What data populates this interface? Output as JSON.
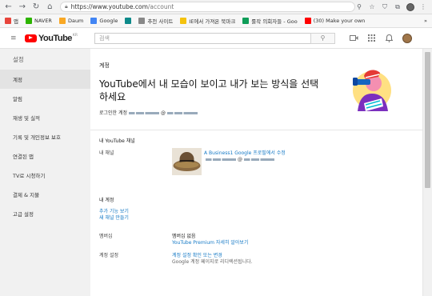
{
  "browser": {
    "url_host": "https://www.youtube.com",
    "url_path": "/account",
    "bookmarks": [
      {
        "label": "앱",
        "color": "#e8453c"
      },
      {
        "label": "NAVER",
        "color": "#2db400"
      },
      {
        "label": "Daum",
        "color": "#f9a825"
      },
      {
        "label": "Google",
        "color": "#4285f4"
      },
      {
        "label": "",
        "color": "#0d8a8a"
      },
      {
        "label": "추천 사이트",
        "color": "#888888"
      },
      {
        "label": "IE에서 가져온 북마크",
        "color": "#f4c20d"
      },
      {
        "label": "룰작 의회자들 - Goo",
        "color": "#0f9d58"
      },
      {
        "label": "(30) Make your own",
        "color": "#ff0000"
      }
    ],
    "more_label": "»"
  },
  "youtube": {
    "logo_word": "YouTube",
    "logo_region": "KR",
    "search_placeholder": "검색"
  },
  "sidebar": {
    "title": "설정",
    "items": [
      {
        "label": "계정",
        "active": true
      },
      {
        "label": "알림",
        "active": false
      },
      {
        "label": "재생 및 실적",
        "active": false
      },
      {
        "label": "기록 및 개인정보 보호",
        "active": false
      },
      {
        "label": "연결된 앱",
        "active": false
      },
      {
        "label": "TV로 시청하기",
        "active": false
      },
      {
        "label": "결제 & 지불",
        "active": false
      },
      {
        "label": "고급 설정",
        "active": false
      }
    ]
  },
  "main": {
    "section_title": "계정",
    "headline": "YouTube에서 내 모습이 보이고 내가 보는 방식을 선택하세요",
    "signed_in_prefix": "로그인한 계정",
    "channel_section": "내 YouTube 채널",
    "channel_label": "내 채널",
    "channel_name": "A Business1 Google 프로필에서 수정",
    "account_section": "내 계정",
    "links": [
      "추가 기능 보기",
      "새 채널 만들기"
    ],
    "membership_label": "멤버십",
    "membership_value": "멤버십 없음",
    "membership_link": "YouTube Premium 자세히 알아보기",
    "settings_label": "계정 설정",
    "settings_link": "계정 설정 확인 또는 변경",
    "settings_note": "Google 계정 페이지로 리디렉션됩니다."
  },
  "colors": {
    "brand_red": "#ff0000",
    "link_blue": "#167ac6"
  }
}
